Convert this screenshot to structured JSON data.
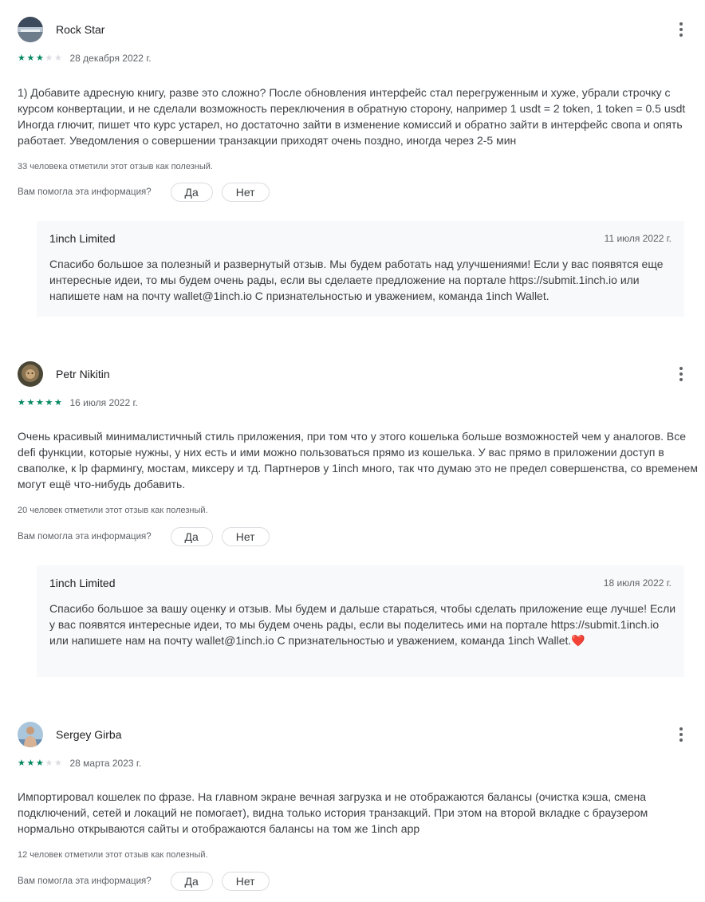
{
  "reviews": [
    {
      "author": "Rock Star",
      "rating": 3,
      "date": "28 декабря 2022 г.",
      "text": "1) Добавите адресную книгу, разве это сложно? После обновления интерфейс стал перегруженным и хуже, убрали строчку с курсом конвертации, и не сделали возможность переключения в обратную сторону, например 1 usdt = 2 token, 1 token = 0.5 usdt Иногда глючит, пишет что курс устарел, но достаточно зайти в изменение комиссий и обратно зайти в интерфейс свопа и опять работает. Уведомления о совершении транзакции приходят очень поздно, иногда через 2-5 мин",
      "helpful_count": "33 человека отметили этот отзыв как полезный.",
      "reply": {
        "name": "1inch Limited",
        "date": "11 июля 2022 г.",
        "text": "Спасибо большое за полезный и развернутый отзыв. Мы будем работать над улучшениями! Если у вас появятся еще интересные идеи, то мы будем очень рады, если вы сделаете предложение на портале https://submit.1inch.io или напишете нам на почту wallet@1inch.io С признательностью и уважением, команда 1inch Wallet."
      }
    },
    {
      "author": "Petr Nikitin",
      "rating": 5,
      "date": "16 июля 2022 г.",
      "text": "Очень красивый минималистичный стиль приложения, при том что у этого кошелька больше возможностей чем у аналогов. Все defi функции, которые нужны, у них есть и ими можно пользоваться прямо из кошелька. У вас прямо в приложении доступ в сваполке, к lp фармингу, мостам, миксеру и тд. Партнеров у 1inch много, так что думаю это не предел совершенства, со временем могут ещё что-нибудь добавить.",
      "helpful_count": "20 человек отметили этот отзыв как полезный.",
      "reply": {
        "name": "1inch Limited",
        "date": "18 июля 2022 г.",
        "text": "Спасибо большое за вашу оценку и отзыв. Мы будем и дальше стараться, чтобы сделать приложение еще лучше! Если у вас появятся интересные идеи, то мы будем очень рады, если вы поделитесь ими на портале https://submit.1inch.io или напишете нам на почту wallet@1inch.io С признательностью и уважением, команда 1inch Wallet.❤️"
      }
    },
    {
      "author": "Sergey Girba",
      "rating": 3,
      "date": "28 марта 2023 г.",
      "text": "Импортировал кошелек по фразе. На главном экране вечная загрузка и не отображаются балансы (очистка кэша, смена подключений, сетей и локаций не помогает), видна только история транзакций. При этом на второй вкладке с браузером нормально открываются сайты и отображаются балансы на том же 1inch app",
      "helpful_count": "12 человек отметили этот отзыв как полезный."
    }
  ],
  "helpful_question": "Вам помогла эта информация?",
  "yes_label": "Да",
  "no_label": "Нет",
  "colors": {
    "star_on": "#01875f",
    "star_off": "#dadce0",
    "reply_bg": "#f8f9fa"
  },
  "icons": {
    "more": "more-vert-icon",
    "star": "star-icon"
  }
}
